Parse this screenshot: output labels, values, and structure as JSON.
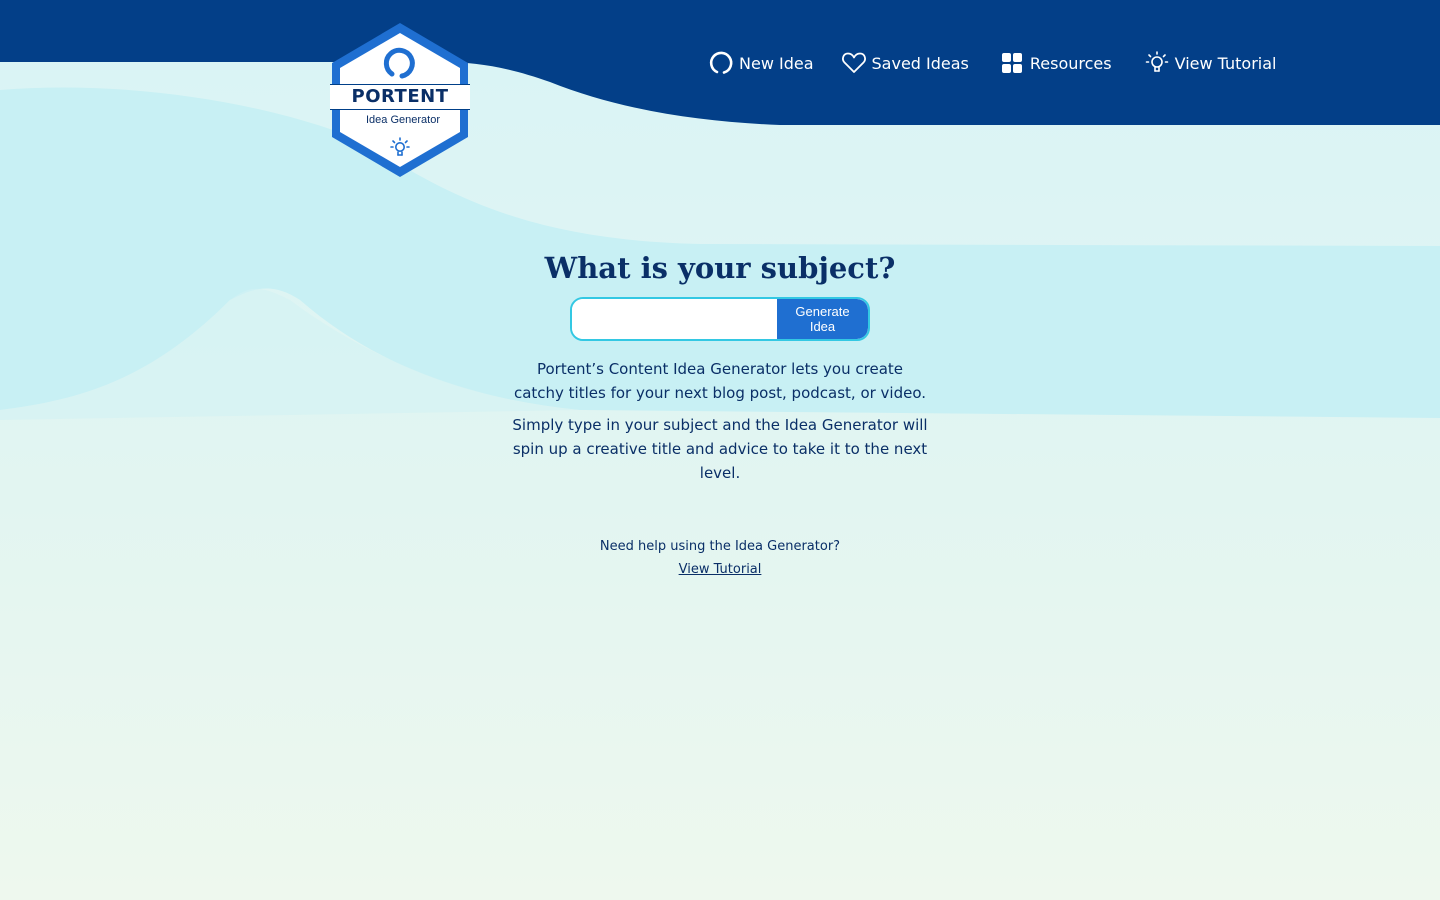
{
  "brand": {
    "name": "PORTENT",
    "tagline": "Idea Generator"
  },
  "nav": {
    "items": [
      {
        "label": "New Idea",
        "icon": "refresh-icon"
      },
      {
        "label": "Saved Ideas",
        "icon": "heart-icon"
      },
      {
        "label": "Resources",
        "icon": "grid-icon"
      },
      {
        "label": "View Tutorial",
        "icon": "lightbulb-icon"
      }
    ]
  },
  "main": {
    "heading": "What is your subject?",
    "input_value": "",
    "input_placeholder": "",
    "button_label": "Generate Idea",
    "description_1": "Portent’s Content Idea Generator lets you create catchy titles for your next blog post, podcast, or video.",
    "description_2": "Simply type in your subject and the Idea Generator will spin up a creative title and advice to take it to the next level."
  },
  "help": {
    "text": "Need help using the Idea Generator?",
    "link_label": "View Tutorial"
  },
  "colors": {
    "header": "#033f88",
    "accent": "#1f6fd1",
    "input_border": "#33c8e3",
    "text": "#0a2f67",
    "background": "#d9f4f6"
  }
}
